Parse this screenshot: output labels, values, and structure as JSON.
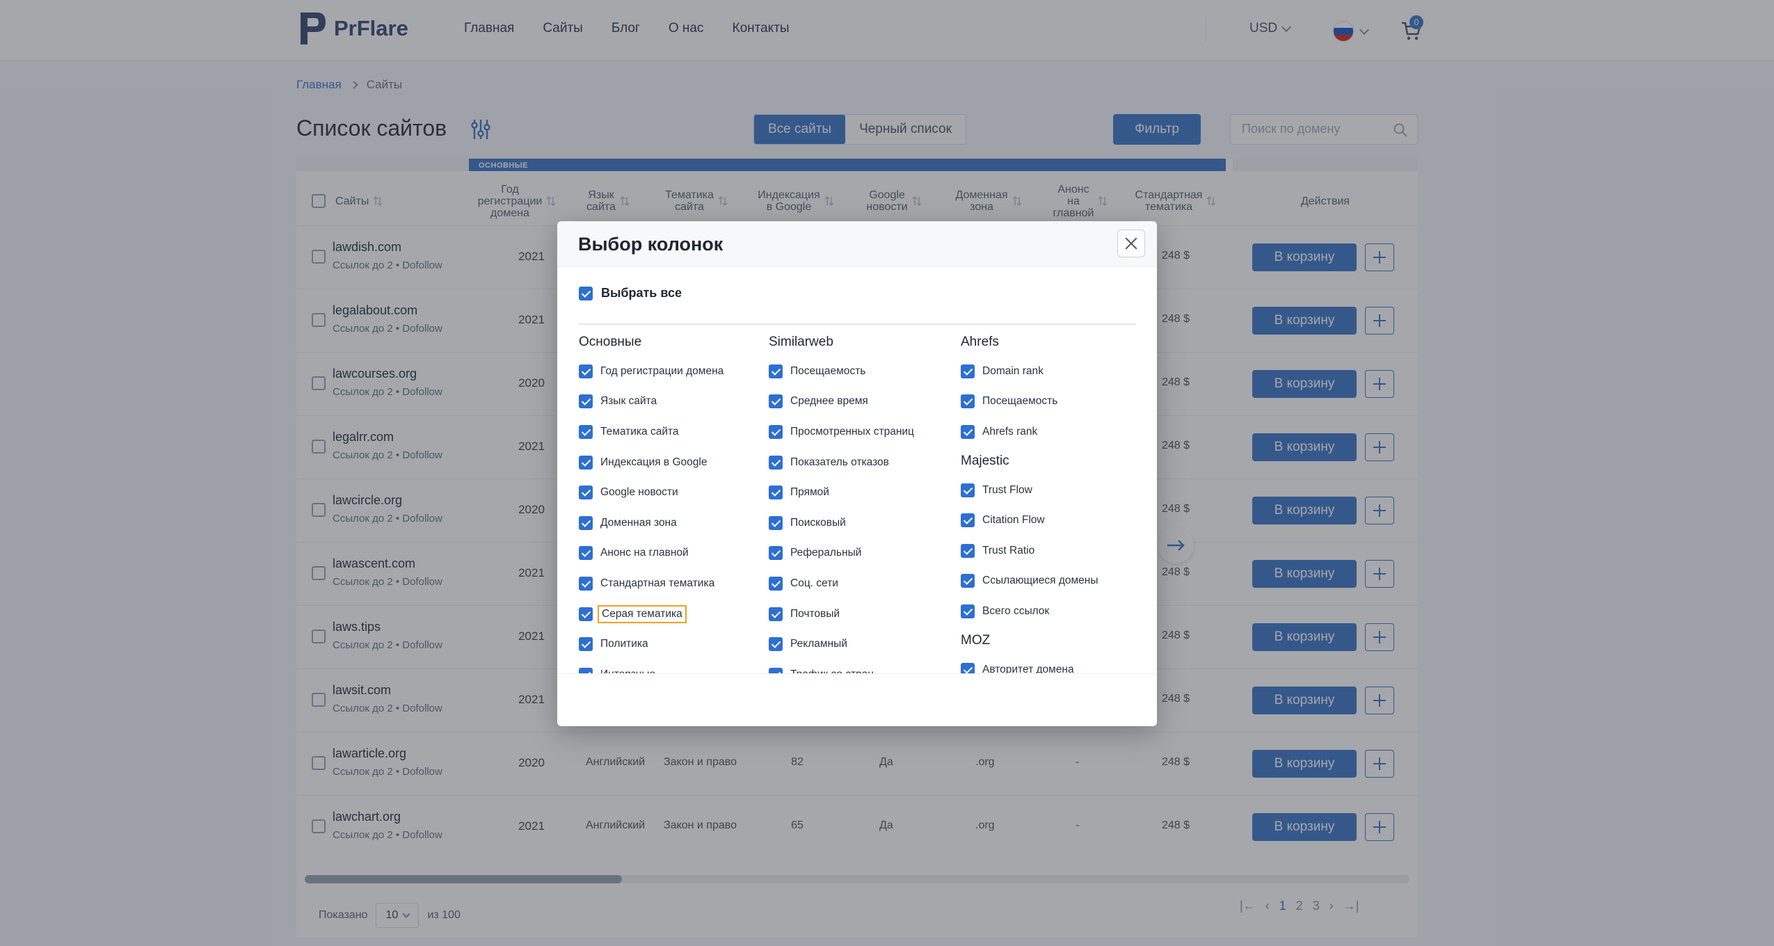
{
  "header": {
    "logo": "PrFlare",
    "nav": [
      "Главная",
      "Сайты",
      "Блог",
      "О нас",
      "Контакты"
    ],
    "currency": "USD",
    "cart_count": "0"
  },
  "breadcrumb": {
    "home": "Главная",
    "current": "Сайты"
  },
  "page": {
    "title": "Список сайтов",
    "tabs": [
      "Все сайты",
      "Черный список"
    ],
    "filter": "Фильтр",
    "search_placeholder": "Поиск по домену"
  },
  "table": {
    "group_label": "ОСНОВНЫЕ",
    "headers": {
      "sites": "Сайты",
      "year": "Год\nрегистрации\nдомена",
      "lang": "Язык\nсайта",
      "theme": "Тематика\nсайта",
      "index": "Индексация\nв Google",
      "gnews": "Google\nновости",
      "zone": "Доменная\nзона",
      "anons": "Анонс\nна\nглавной",
      "std": "Стандартная\nтематика",
      "actions": "Действия"
    },
    "rows": [
      {
        "site": "lawdish.com",
        "sub": "Ссылок до 2 • Dofollow",
        "year": "2021",
        "lang": "",
        "theme": "",
        "index": "",
        "gnews": "",
        "zone": "",
        "anons": "",
        "price": "248 $"
      },
      {
        "site": "legalabout.com",
        "sub": "Ссылок до 2 • Dofollow",
        "year": "2021",
        "lang": "",
        "theme": "",
        "index": "",
        "gnews": "",
        "zone": "",
        "anons": "",
        "price": "248 $"
      },
      {
        "site": "lawcourses.org",
        "sub": "Ссылок до 2 • Dofollow",
        "year": "2020",
        "lang": "",
        "theme": "",
        "index": "",
        "gnews": "",
        "zone": "",
        "anons": "",
        "price": "248 $"
      },
      {
        "site": "legalrr.com",
        "sub": "Ссылок до 2 • Dofollow",
        "year": "2021",
        "lang": "",
        "theme": "",
        "index": "",
        "gnews": "",
        "zone": "",
        "anons": "",
        "price": "248 $"
      },
      {
        "site": "lawcircle.org",
        "sub": "Ссылок до 2 • Dofollow",
        "year": "2020",
        "lang": "",
        "theme": "",
        "index": "",
        "gnews": "",
        "zone": "",
        "anons": "",
        "price": "248 $"
      },
      {
        "site": "lawascent.com",
        "sub": "Ссылок до 2 • Dofollow",
        "year": "2021",
        "lang": "",
        "theme": "",
        "index": "",
        "gnews": "",
        "zone": "",
        "anons": "",
        "price": "248 $"
      },
      {
        "site": "laws.tips",
        "sub": "Ссылок до 2 • Dofollow",
        "year": "2021",
        "lang": "",
        "theme": "",
        "index": "",
        "gnews": "",
        "zone": "",
        "anons": "",
        "price": "248 $"
      },
      {
        "site": "lawsit.com",
        "sub": "Ссылок до 2 • Dofollow",
        "year": "2021",
        "lang": "",
        "theme": "",
        "index": "",
        "gnews": "",
        "zone": "",
        "anons": "",
        "price": "248 $"
      },
      {
        "site": "lawarticle.org",
        "sub": "Ссылок до 2 • Dofollow",
        "year": "2020",
        "lang": "Английский",
        "theme": "Закон и право",
        "index": "82",
        "gnews": "Да",
        "zone": ".org",
        "anons": "-",
        "price": "248 $"
      },
      {
        "site": "lawchart.org",
        "sub": "Ссылок до 2 • Dofollow",
        "year": "2021",
        "lang": "Английский",
        "theme": "Закон и право",
        "index": "65",
        "gnews": "Да",
        "zone": ".org",
        "anons": "-",
        "price": "248 $"
      }
    ],
    "buy_label": "В корзину",
    "shown_label": "Показано",
    "per_page": "10",
    "of_total": "из 100",
    "pages": [
      "1",
      "2",
      "3"
    ]
  },
  "modal": {
    "title": "Выбор колонок",
    "select_all": "Выбрать все",
    "columns": [
      {
        "groups": [
          {
            "title": "Основные",
            "items": [
              "Год регистрации домена",
              "Язык сайта",
              "Тематика сайта",
              "Индексация в Google",
              "Google новости",
              "Доменная зона",
              "Анонс на главной",
              "Стандартная тематика",
              "Серая тематика",
              "Политика",
              "Интерзные"
            ]
          }
        ]
      },
      {
        "groups": [
          {
            "title": "Similarweb",
            "items": [
              "Посещаемость",
              "Среднее время",
              "Просмотренных страниц",
              "Показатель отказов",
              "Прямой",
              "Поисковый",
              "Реферальный",
              "Соц. сети",
              "Почтовый",
              "Рекламный",
              "Трафик со стран"
            ]
          }
        ]
      },
      {
        "groups": [
          {
            "title": "Ahrefs",
            "items": [
              "Domain rank",
              "Посещаемость",
              "Ahrefs rank"
            ]
          },
          {
            "title": "Majestic",
            "items": [
              "Trust Flow",
              "Citation Flow",
              "Trust Ratio",
              "Ссылающиеся домены",
              "Всего ссылок"
            ]
          },
          {
            "title": "MOZ",
            "items": [
              "Авторитет домена"
            ]
          }
        ]
      }
    ],
    "focused_item": "Серая тематика"
  },
  "colors": {
    "accent": "#3f78c8",
    "checkbox": "#2d6fd2",
    "focus": "#f2a024"
  }
}
